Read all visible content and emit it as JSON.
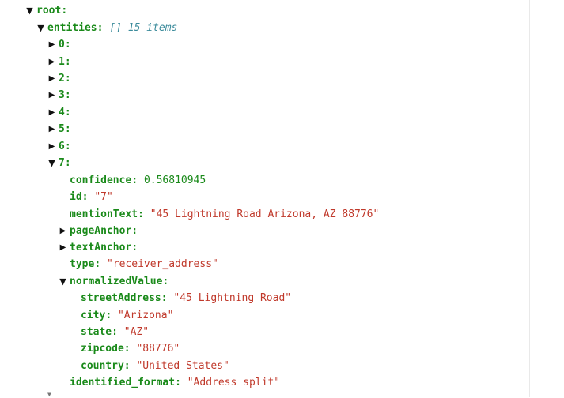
{
  "tree": {
    "root_key": "root",
    "entities_key": "entities",
    "entities_meta": "[] 15 items",
    "collapsed_indices": [
      "0",
      "1",
      "2",
      "3",
      "4",
      "5",
      "6"
    ],
    "expanded_index": "7",
    "item": {
      "confidence_key": "confidence",
      "confidence_value": "0.56810945",
      "id_key": "id",
      "id_value": "\"7\"",
      "mentionText_key": "mentionText",
      "mentionText_value": "\"45 Lightning Road Arizona, AZ 88776\"",
      "pageAnchor_key": "pageAnchor",
      "textAnchor_key": "textAnchor",
      "type_key": "type",
      "type_value": "\"receiver_address\"",
      "normalizedValue_key": "normalizedValue",
      "normalizedValue": {
        "streetAddress_key": "streetAddress",
        "streetAddress_value": "\"45 Lightning Road\"",
        "city_key": "city",
        "city_value": "\"Arizona\"",
        "state_key": "state",
        "state_value": "\"AZ\"",
        "zipcode_key": "zipcode",
        "zipcode_value": "\"88776\"",
        "country_key": "country",
        "country_value": "\"United States\""
      },
      "identified_format_key": "identified_format",
      "identified_format_value": "\"Address split\""
    }
  },
  "icons": {
    "expanded": "triangle-down-icon",
    "collapsed": "triangle-right-icon"
  },
  "colors": {
    "key": "#1a8a1a",
    "number": "#1a8a1a",
    "string": "#c0392b",
    "meta": "#3b8b9b"
  }
}
